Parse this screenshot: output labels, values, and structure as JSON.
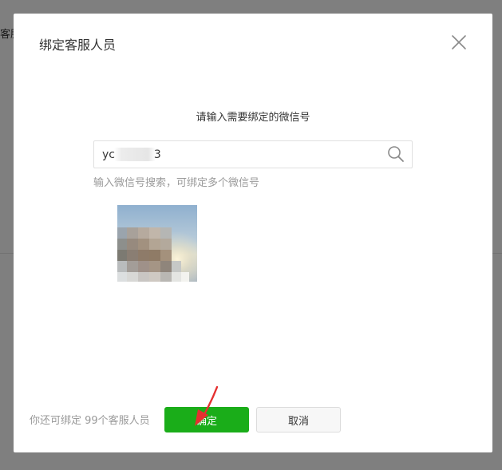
{
  "background": {
    "crumb_fragment": "客服"
  },
  "dialog": {
    "title": "绑定客服人员",
    "prompt": "请输入需要绑定的微信号",
    "search": {
      "value": "yc           3",
      "icon": "search-icon"
    },
    "hint": "输入微信号搜索，可绑定多个微信号",
    "result": {
      "avatar": "blurred-profile-photo"
    },
    "footer": {
      "remaining_text": "你还可绑定 99个客服人员",
      "confirm_label": "确定",
      "cancel_label": "取消"
    }
  },
  "colors": {
    "primary_green": "#1aad19",
    "annotation_red": "#e53030",
    "overlay": "rgba(0,0,0,0.5)"
  }
}
